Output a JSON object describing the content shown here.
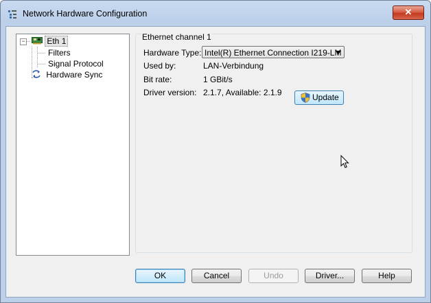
{
  "window": {
    "title": "Network Hardware Configuration",
    "close_label": "✕"
  },
  "tree": {
    "items": [
      {
        "label": "Eth 1",
        "expander": "−"
      },
      {
        "label": "Filters"
      },
      {
        "label": "Signal Protocol"
      },
      {
        "label": "Hardware Sync"
      }
    ]
  },
  "panel": {
    "group_title": "Ethernet channel 1",
    "hardware_type_label": "Hardware Type:",
    "hardware_type_value": "Intel(R) Ethernet Connection I219-LM",
    "used_by_label": "Used by:",
    "used_by_value": "LAN-Verbindung",
    "bit_rate_label": "Bit rate:",
    "bit_rate_value": "1 GBit/s",
    "driver_version_label": "Driver version:",
    "driver_version_value": "2.1.7, Available: 2.1.9",
    "update_label": "Update"
  },
  "buttons": {
    "ok": "OK",
    "cancel": "Cancel",
    "undo": "Undo",
    "driver": "Driver...",
    "help": "Help"
  },
  "colors": {
    "accent": "#3c7fb1",
    "close": "#c33a20"
  },
  "icons": {
    "title": "tree-list-icon",
    "eth": "network-card-icon",
    "sync": "sync-arrows-icon",
    "update": "uac-shield-icon"
  }
}
